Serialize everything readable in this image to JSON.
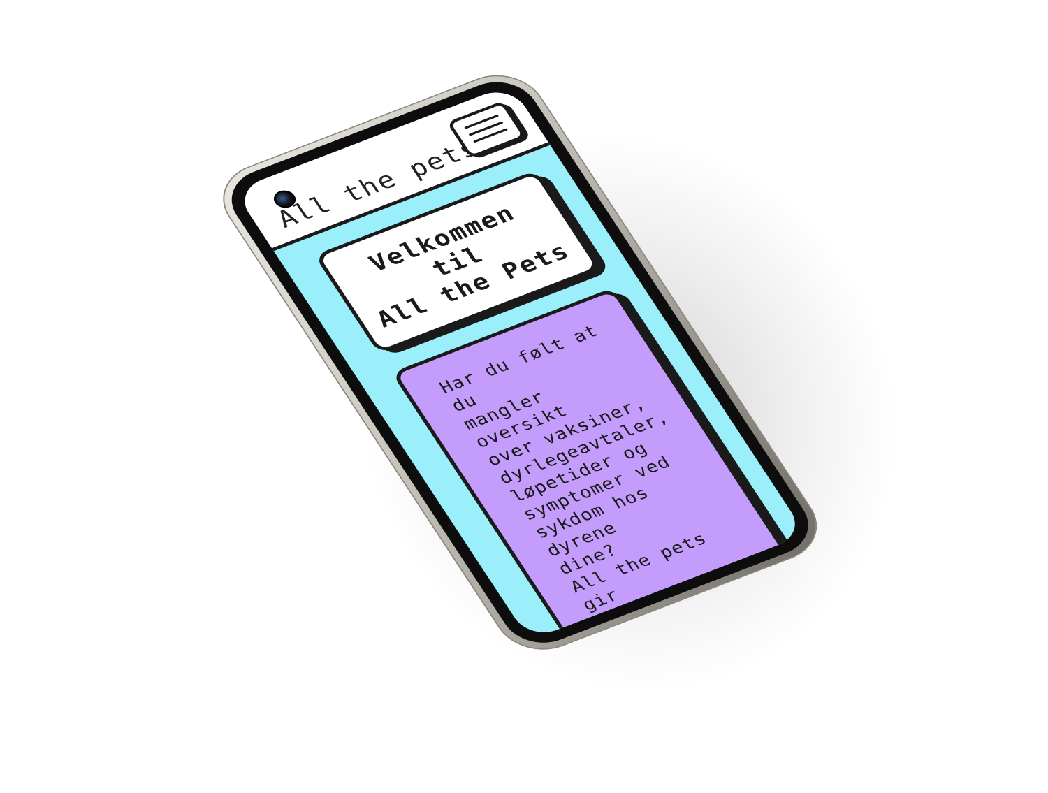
{
  "app": {
    "title": "All the pets"
  },
  "header": {
    "menu_icon": "hamburger-menu-icon"
  },
  "welcome": {
    "line1": "Velkommen",
    "line2": "til",
    "line3": "All the Pets"
  },
  "info": {
    "text": "Har du følt at du\nmangler oversikt\nover vaksiner,\ndyrlegeavtaler,\nløpetider og\nsymptomer ved\nsykdom hos dyrene\ndine?\nAll the pets gir\ndeg den\noversikten du\ntrenger for et\nryddig og\norganisert\ndyrehold - rett\npå mobilen!"
  },
  "colors": {
    "screen_bg": "#9aeffb",
    "card_purple": "#c39cfc",
    "header_bg": "#ffffff",
    "ink": "#1a1a1a"
  }
}
